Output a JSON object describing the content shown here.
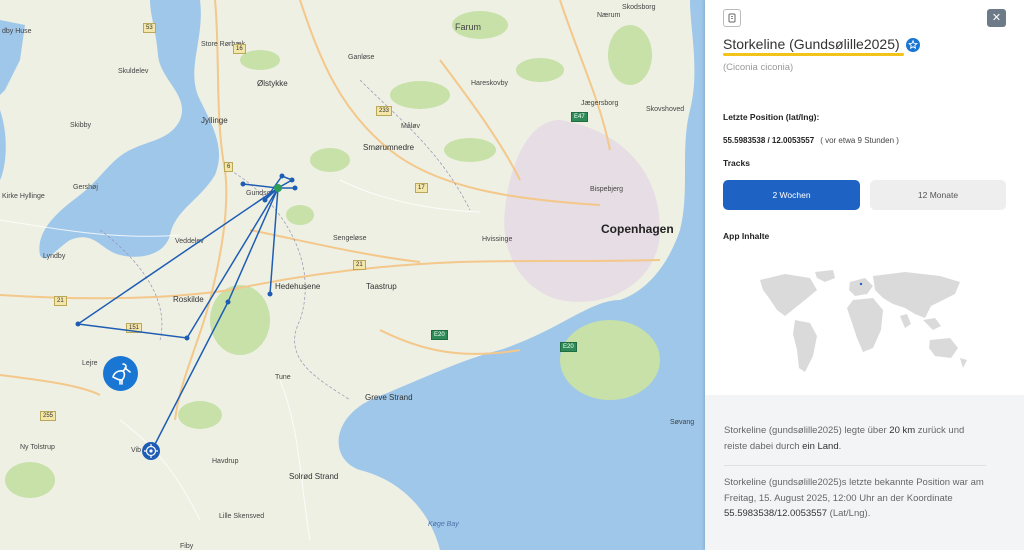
{
  "map": {
    "places": [
      {
        "id": "farum",
        "name": "Farum"
      },
      {
        "id": "skodsborg",
        "name": "Skodsborg"
      },
      {
        "id": "naerum",
        "name": "Nærum"
      },
      {
        "id": "store-rorbaek",
        "name": "Store Rørbæk"
      },
      {
        "id": "ganlose",
        "name": "Ganløse"
      },
      {
        "id": "olstykke",
        "name": "Ølstykke"
      },
      {
        "id": "skuldelev",
        "name": "Skuldelev"
      },
      {
        "id": "jyllinge",
        "name": "Jyllinge"
      },
      {
        "id": "hareskovby",
        "name": "Hareskovby"
      },
      {
        "id": "jaegersborg",
        "name": "Jægersborg"
      },
      {
        "id": "skovshoved",
        "name": "Skovshoved"
      },
      {
        "id": "skibby",
        "name": "Skibby"
      },
      {
        "id": "malov",
        "name": "Måløv"
      },
      {
        "id": "smorumnedre",
        "name": "Smørumnedre"
      },
      {
        "id": "gershoj",
        "name": "Gershøj"
      },
      {
        "id": "kirke-hyllinge",
        "name": "Kirke Hyllinge"
      },
      {
        "id": "gundso",
        "name": "Gundsø"
      },
      {
        "id": "bispebjerg",
        "name": "Bispebjerg"
      },
      {
        "id": "veddelev",
        "name": "Veddelev"
      },
      {
        "id": "sengelose",
        "name": "Sengeløse"
      },
      {
        "id": "hvissinge",
        "name": "Hvissinge"
      },
      {
        "id": "lyndby",
        "name": "Lyndby"
      },
      {
        "id": "hedehusene",
        "name": "Hedehusene"
      },
      {
        "id": "taastrup",
        "name": "Taastrup"
      },
      {
        "id": "roskilde",
        "name": "Roskilde"
      },
      {
        "id": "lejre",
        "name": "Lejre"
      },
      {
        "id": "tune",
        "name": "Tune"
      },
      {
        "id": "greve-strand",
        "name": "Greve Strand"
      },
      {
        "id": "ny-tolstrup",
        "name": "Ny Tolstrup"
      },
      {
        "id": "vib",
        "name": "Vib"
      },
      {
        "id": "havdrup",
        "name": "Havdrup"
      },
      {
        "id": "solrod-strand",
        "name": "Solrød Strand"
      },
      {
        "id": "sovang",
        "name": "Søvang"
      },
      {
        "id": "lille-skensved",
        "name": "Lille Skensved"
      },
      {
        "id": "koge-bay",
        "name": "Køge Bay"
      },
      {
        "id": "fiby",
        "name": "Fiby"
      },
      {
        "id": "copenhagen",
        "name": "Copenhagen"
      },
      {
        "id": "dby-huse",
        "name": "dby Huse"
      }
    ],
    "road_shields": [
      "53",
      "16",
      "233",
      "E47",
      "6",
      "17",
      "21",
      "21",
      "E20",
      "E20",
      "255",
      "151"
    ]
  },
  "panel": {
    "title": "Storkeline (Gundsølille2025)",
    "latin_name": "(Ciconia ciconia)",
    "last_position_label": "Letzte Position (lat/lng):",
    "last_position_value": "55.5983538 / 12.0053557",
    "last_position_ago": "( vor etwa 9 Stunden )",
    "tracks_label": "Tracks",
    "track_buttons": [
      "2 Wochen",
      "12 Monate"
    ],
    "app_content_label": "App Inhalte",
    "summary": {
      "pre": "Storkeline (gundsølille2025) legte über ",
      "distance": "20 km",
      "mid": " zurück und reiste dabei durch ",
      "countries": "ein Land",
      "post": "."
    },
    "last_known": {
      "pre": "Storkeline (gundsølille2025)s letzte bekannte Position war am Freitag, 15. August 2025, 12:00 Uhr an der Koordinate ",
      "coord": "55.5983538/12.0053557",
      "post": " (Lat/Lng)."
    },
    "colors": {
      "accent": "#1e63c4",
      "highlight": "#f2c318",
      "track": "#1e5db3"
    }
  }
}
